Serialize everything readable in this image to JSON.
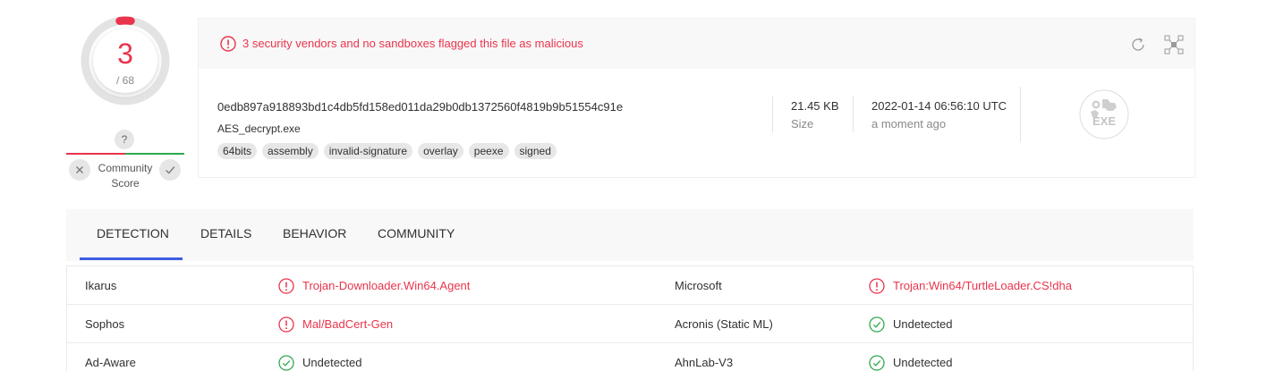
{
  "score": {
    "detections": "3",
    "total": "/ 68",
    "fraction_detected": 0.044
  },
  "community": {
    "question": "?",
    "label_line1": "Community",
    "label_line2": "Score"
  },
  "colors": {
    "malicious": "#e9344c",
    "clean": "#2fa84f",
    "accent": "#3e5ce3"
  },
  "alert": {
    "text": "3 security vendors and no sandboxes flagged this file as malicious"
  },
  "file": {
    "hash": "0edb897a918893bd1c4db5fd158ed011da29b0db1372560f4819b9b51554c91e",
    "name": "AES_decrypt.exe",
    "tags": [
      "64bits",
      "assembly",
      "invalid-signature",
      "overlay",
      "peexe",
      "signed"
    ],
    "size_value": "21.45 KB",
    "size_label": "Size",
    "date_value": "2022-01-14 06:56:10 UTC",
    "date_label": "a moment ago",
    "type_icon_text": "EXE"
  },
  "tabs": [
    {
      "label": "DETECTION",
      "active": true
    },
    {
      "label": "DETAILS",
      "active": false
    },
    {
      "label": "BEHAVIOR",
      "active": false
    },
    {
      "label": "COMMUNITY",
      "active": false
    }
  ],
  "detections": [
    {
      "left": {
        "vendor": "Ikarus",
        "result": "Trojan-Downloader.Win64.Agent",
        "status": "malicious"
      },
      "right": {
        "vendor": "Microsoft",
        "result": "Trojan:Win64/TurtleLoader.CS!dha",
        "status": "malicious"
      }
    },
    {
      "left": {
        "vendor": "Sophos",
        "result": "Mal/BadCert-Gen",
        "status": "malicious"
      },
      "right": {
        "vendor": "Acronis (Static ML)",
        "result": "Undetected",
        "status": "clean"
      }
    },
    {
      "left": {
        "vendor": "Ad-Aware",
        "result": "Undetected",
        "status": "clean"
      },
      "right": {
        "vendor": "AhnLab-V3",
        "result": "Undetected",
        "status": "clean"
      }
    }
  ]
}
